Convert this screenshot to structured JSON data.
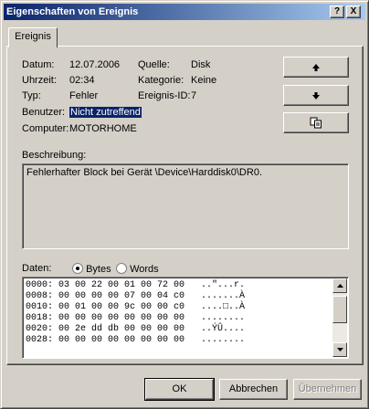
{
  "window": {
    "title": "Eigenschaften von Ereignis",
    "help_btn": "?",
    "close_btn": "X"
  },
  "tab": {
    "label": "Ereignis"
  },
  "fields": {
    "datum_label": "Datum:",
    "datum_value": "12.07.2006",
    "uhrzeit_label": "Uhrzeit:",
    "uhrzeit_value": "02:34",
    "typ_label": "Typ:",
    "typ_value": "Fehler",
    "benutzer_label": "Benutzer:",
    "benutzer_value": "Nicht zutreffend",
    "computer_label": "Computer:",
    "computer_value": "MOTORHOME",
    "quelle_label": "Quelle:",
    "quelle_value": "Disk",
    "kategorie_label": "Kategorie:",
    "kategorie_value": "Keine",
    "ereignis_id_label": "Ereignis-ID:",
    "ereignis_id_value": "7"
  },
  "side_buttons": {
    "up": "arrow-up-icon",
    "down": "arrow-down-icon",
    "copy": "copy-icon"
  },
  "description": {
    "label": "Beschreibung:",
    "text": "Fehlerhafter Block bei Gerät \\Device\\Harddisk0\\DR0."
  },
  "data": {
    "label": "Daten:",
    "bytes_label": "Bytes",
    "words_label": "Words",
    "selected": "Bytes",
    "rows": [
      "0000: 03 00 22 00 01 00 72 00   ..\"...r.",
      "0008: 00 00 00 00 07 00 04 c0   .......À",
      "0010: 00 01 00 00 9c 00 00 c0   ....□..À",
      "0018: 00 00 00 00 00 00 00 00   ........",
      "0020: 00 2e dd db 00 00 00 00   ..ÝÛ....",
      "0028: 00 00 00 00 00 00 00 00   ........"
    ]
  },
  "buttons": {
    "ok": "OK",
    "cancel": "Abbrechen",
    "apply": "Übernehmen"
  }
}
